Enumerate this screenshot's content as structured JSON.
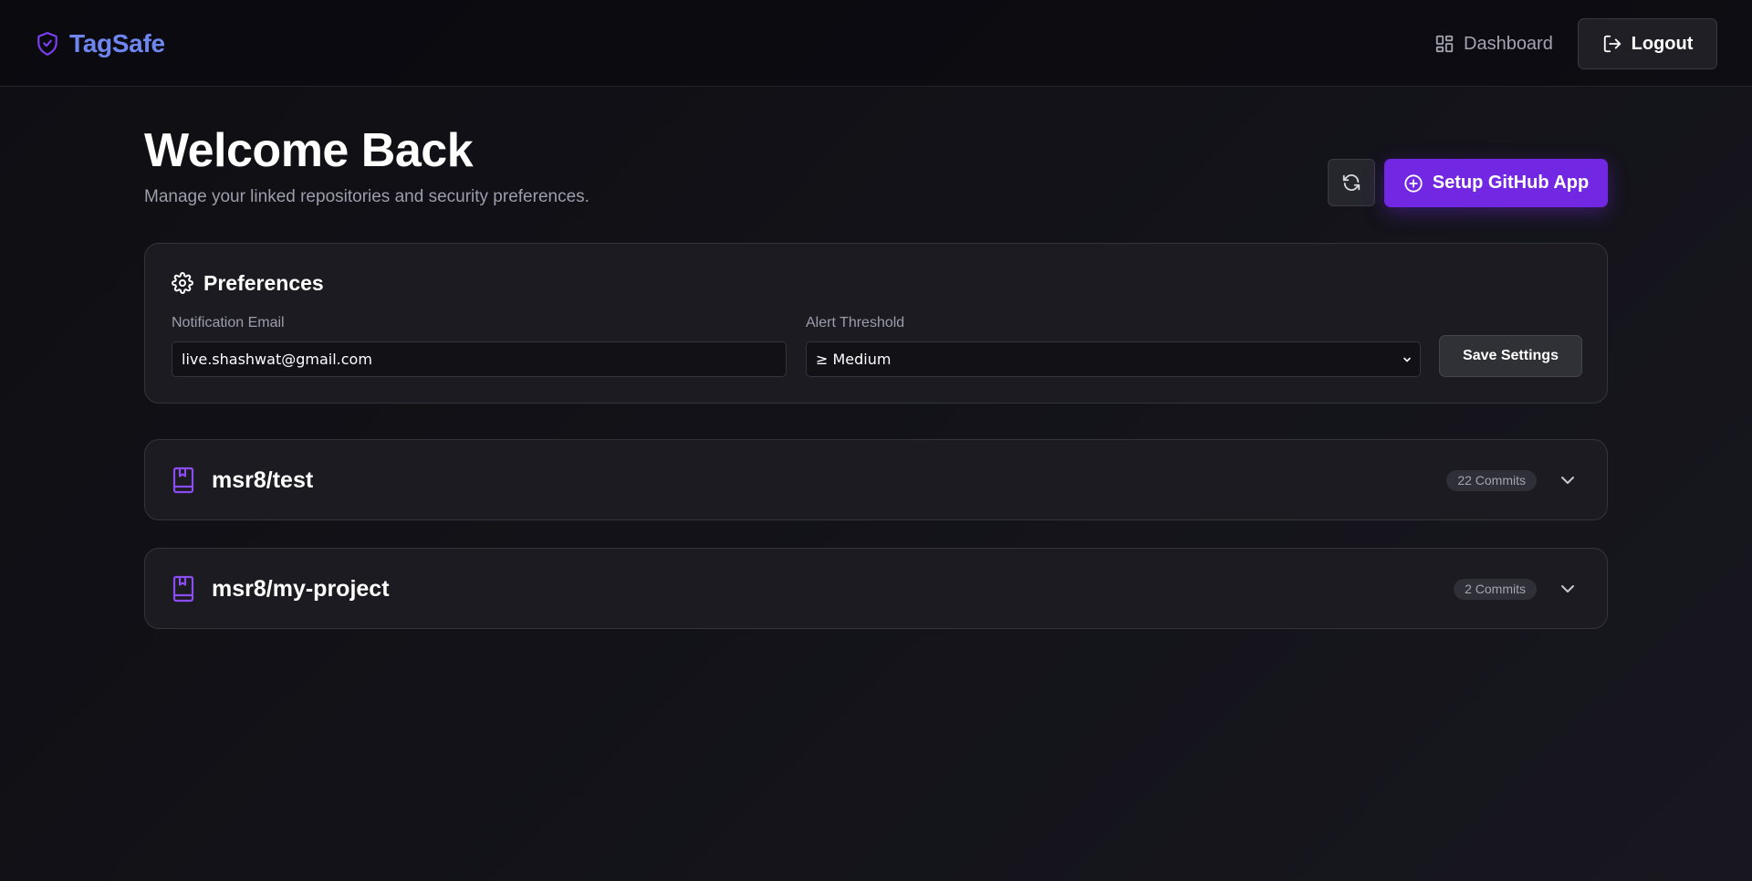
{
  "app": {
    "name": "TagSafe",
    "icons": {
      "logo": "shield-check-icon"
    }
  },
  "header": {
    "dashboard_label": "Dashboard",
    "logout_label": "Logout",
    "icons": {
      "dashboard": "layout-grid-icon",
      "logout": "logout-icon"
    }
  },
  "main": {
    "title": "Welcome Back",
    "subtitle": "Manage your linked repositories and security preferences.",
    "setup_label": "Setup GitHub App",
    "icons": {
      "refresh": "refresh-icon",
      "setup": "plus-circle-icon"
    }
  },
  "preferences": {
    "title": "Preferences",
    "email_label": "Notification Email",
    "email_value": "live.shashwat@gmail.com",
    "threshold_label": "Alert Threshold",
    "threshold_value": "≥ Medium",
    "save_label": "Save Settings",
    "icons": {
      "title": "gear-icon",
      "select": "chevron-down-icon"
    }
  },
  "repositories": [
    {
      "name": "msr8/test",
      "commits": "22 Commits"
    },
    {
      "name": "msr8/my-project",
      "commits": "2 Commits"
    }
  ],
  "colors": {
    "background": "#121218",
    "brand": "#6f86ee",
    "accent": "#7228e2",
    "card": "#1b1b21",
    "muted_text": "#9d9dab"
  }
}
